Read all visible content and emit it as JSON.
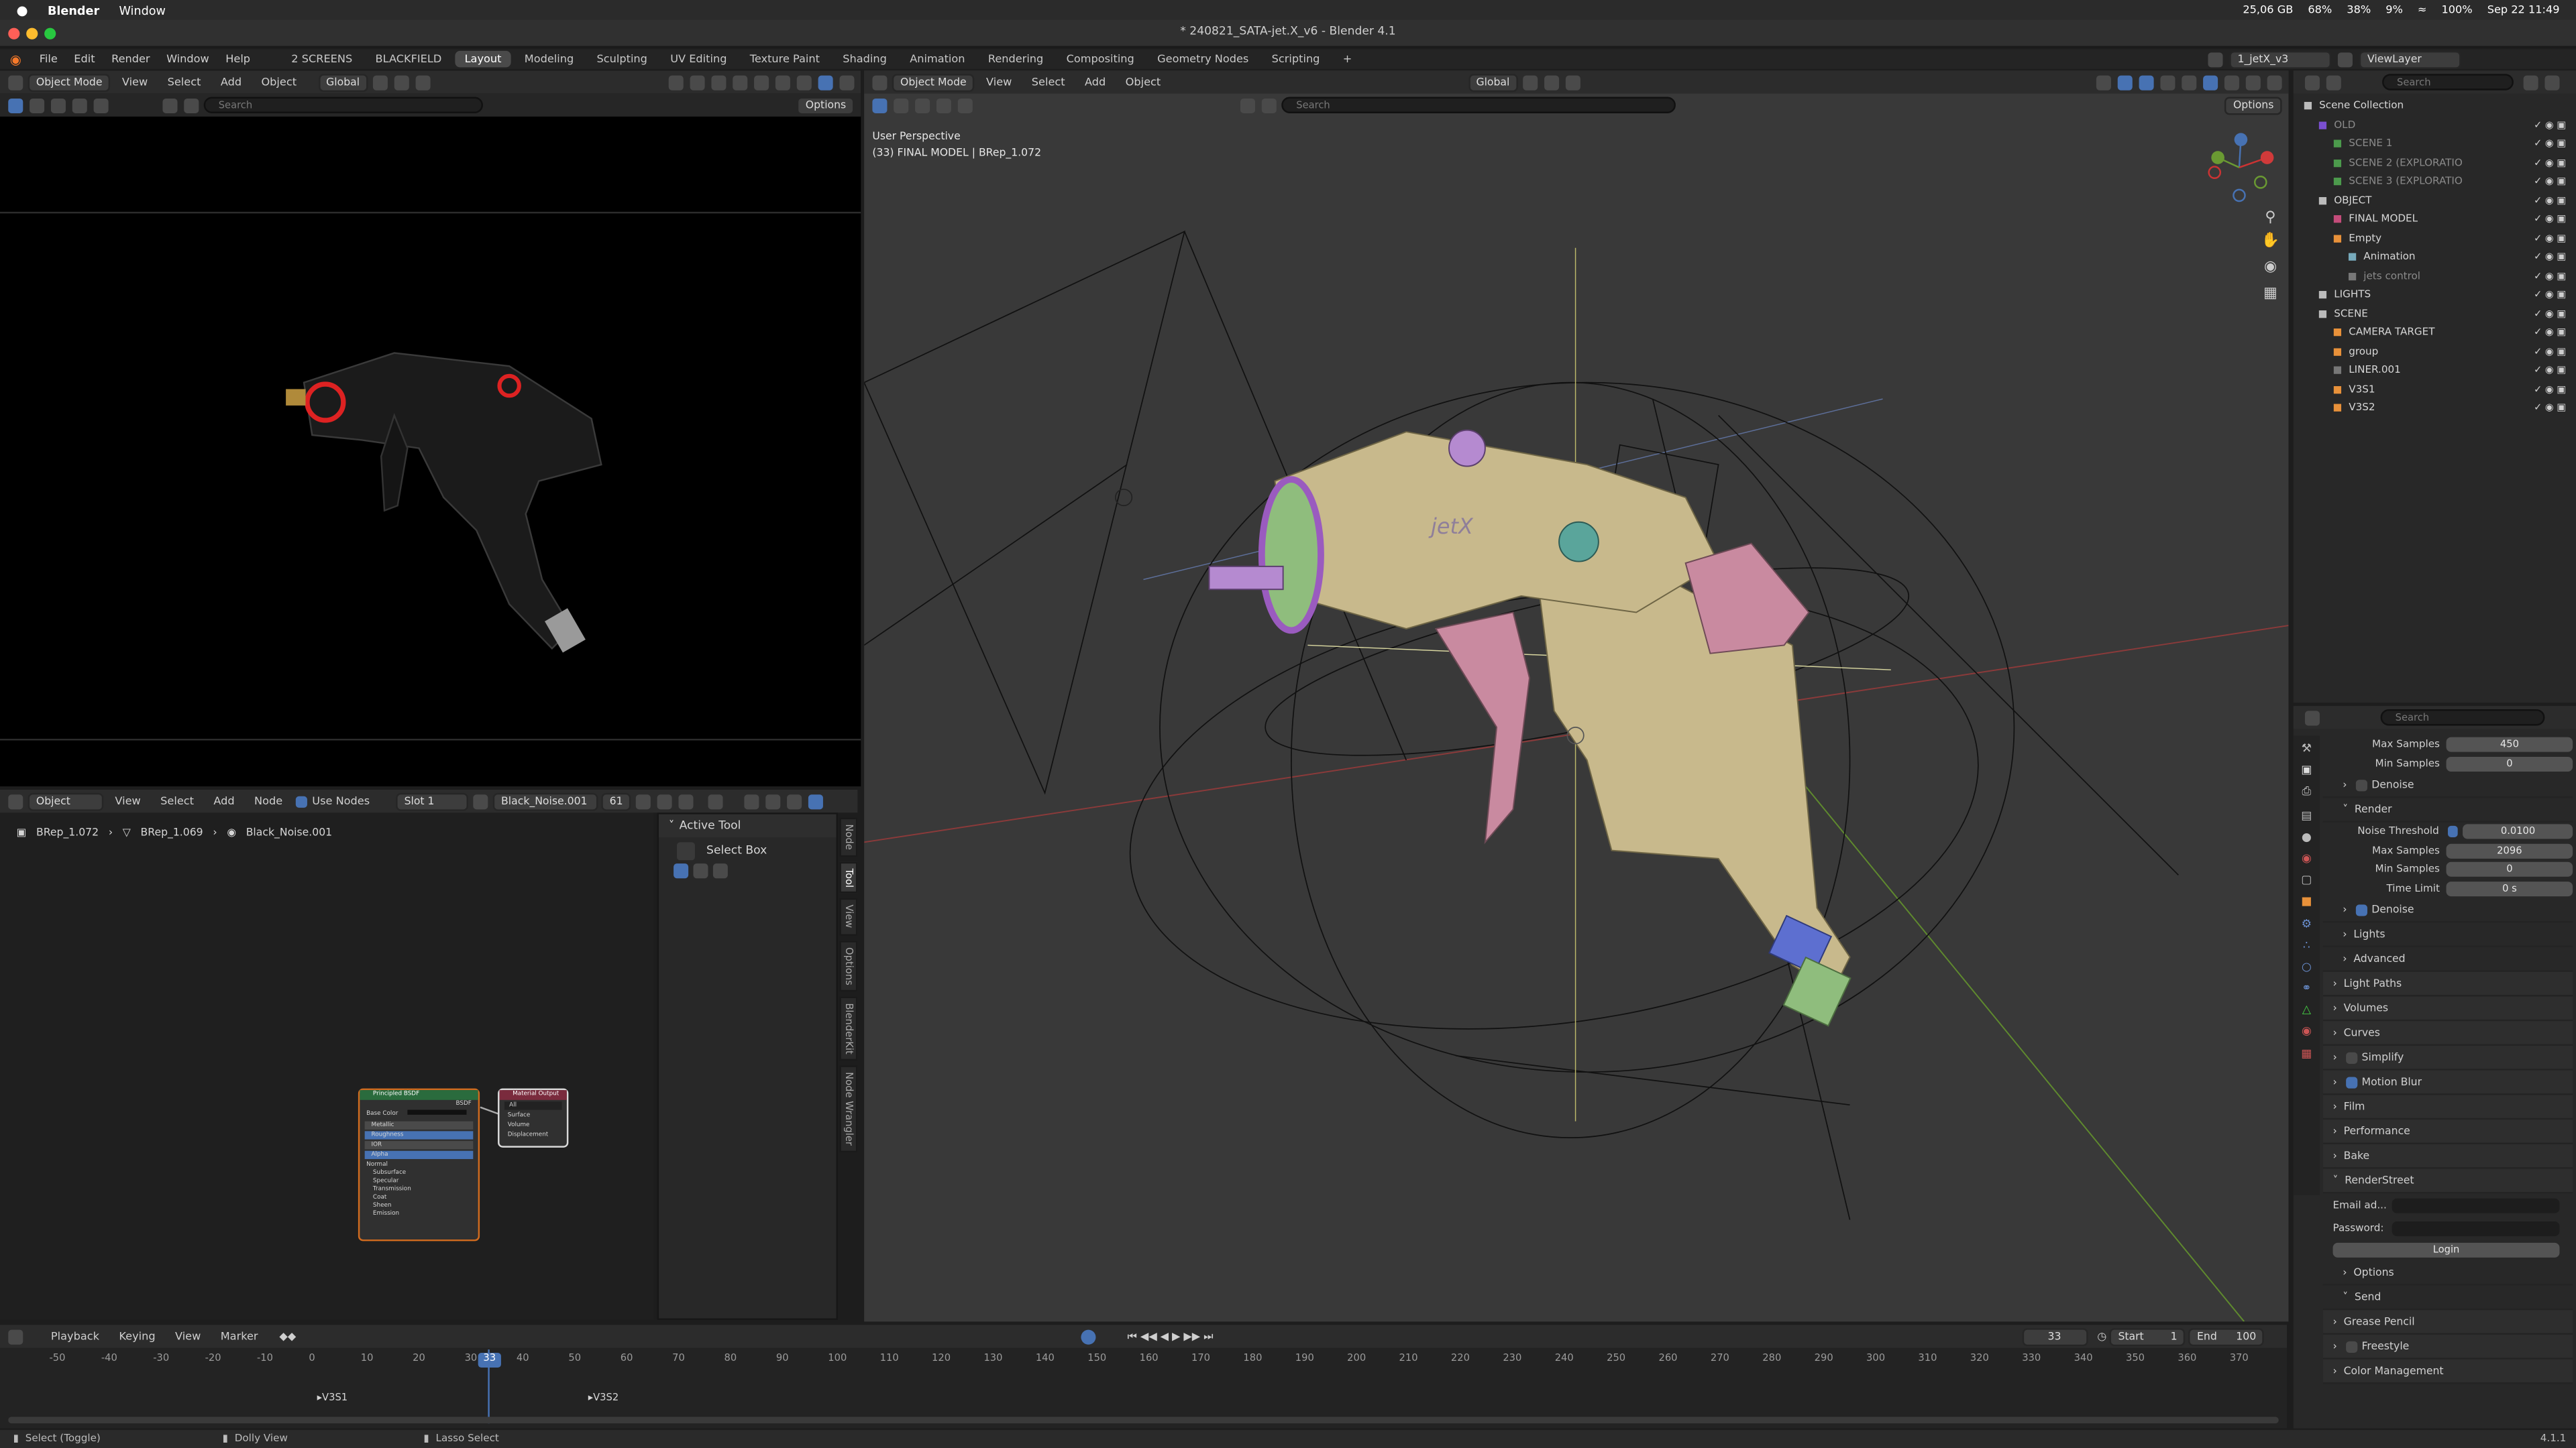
{
  "mac_menubar": {
    "app": "Blender",
    "menu": "Window",
    "storage": "25,06 GB",
    "stat1": "68%",
    "stat2": "38%",
    "stat3": "9%",
    "battery": "100%",
    "datetime": "Sep 22  11:49"
  },
  "window_title": "* 240821_SATA-jet.X_v6 - Blender 4.1",
  "top_menu": [
    "File",
    "Edit",
    "Render",
    "Window",
    "Help"
  ],
  "workspaces": [
    "2 SCREENS",
    "BLACKFIELD",
    "Layout",
    "Modeling",
    "Sculpting",
    "UV Editing",
    "Texture Paint",
    "Shading",
    "Animation",
    "Rendering",
    "Compositing",
    "Geometry Nodes",
    "Scripting"
  ],
  "active_workspace": "Layout",
  "scene_field": "1_jetX_v3",
  "view_layer": "ViewLayer",
  "left_viewport": {
    "mode": "Object Mode",
    "menus": [
      "View",
      "Select",
      "Add",
      "Object"
    ],
    "orientation": "Global",
    "options": "Options",
    "search": "Search"
  },
  "main_viewport": {
    "mode": "Object Mode",
    "menus": [
      "View",
      "Select",
      "Add",
      "Object"
    ],
    "orientation": "Global",
    "options": "Options",
    "search": "Search",
    "overlay_line1": "User Perspective",
    "overlay_line2": "(33) FINAL MODEL | BRep_1.072",
    "model_label": "jetX"
  },
  "node_editor": {
    "type": "Object",
    "menus": [
      "View",
      "Select",
      "Add",
      "Node"
    ],
    "use_nodes": "Use Nodes",
    "slot": "Slot 1",
    "material": "Black_Noise.001",
    "users": "61",
    "breadcrumb": [
      "BRep_1.072",
      "BRep_1.069",
      "Black_Noise.001"
    ],
    "node1": {
      "title": "Principled BSDF",
      "out": "BSDF",
      "rows": [
        "Base Color",
        "Metallic",
        "Roughness",
        "IOR",
        "Alpha",
        "Normal",
        "Subsurface",
        "Specular",
        "Transmission",
        "Coat",
        "Sheen",
        "Emission"
      ]
    },
    "node2": {
      "title": "Material Output",
      "sel": "All",
      "rows": [
        "Surface",
        "Volume",
        "Displacement"
      ]
    }
  },
  "sidebar": {
    "section": "Active Tool",
    "tool": "Select Box",
    "tabs": [
      "Node",
      "Tool",
      "View",
      "Options",
      "BlenderKit",
      "Node Wrangler"
    ]
  },
  "outliner": {
    "search": "Search",
    "items": [
      {
        "label": "Scene Collection",
        "indent": 0
      },
      {
        "label": "OLD",
        "indent": 1
      },
      {
        "label": "SCENE 1",
        "indent": 2
      },
      {
        "label": "SCENE 2 (EXPLORATIO",
        "indent": 2
      },
      {
        "label": "SCENE 3 (EXPLORATIO",
        "indent": 2
      },
      {
        "label": "OBJECT",
        "indent": 1
      },
      {
        "label": "FINAL MODEL",
        "indent": 2
      },
      {
        "label": "Empty",
        "indent": 2
      },
      {
        "label": "Animation",
        "indent": 3
      },
      {
        "label": "jets control",
        "indent": 3
      },
      {
        "label": "LIGHTS",
        "indent": 1
      },
      {
        "label": "SCENE",
        "indent": 1
      },
      {
        "label": "CAMERA TARGET",
        "indent": 2
      },
      {
        "label": "group",
        "indent": 2
      },
      {
        "label": "LINER.001",
        "indent": 2
      },
      {
        "label": "V3S1",
        "indent": 2
      },
      {
        "label": "V3S2",
        "indent": 2
      }
    ]
  },
  "properties": {
    "search": "Search",
    "rows": [
      {
        "label": "Max Samples",
        "value": "450",
        "kind": "field"
      },
      {
        "label": "Min Samples",
        "value": "0",
        "kind": "field"
      },
      {
        "label": "Denoise",
        "kind": "sub-check"
      },
      {
        "label": "Render",
        "kind": "sub-open"
      },
      {
        "label": "Noise Threshold",
        "value": "0.0100",
        "kind": "check-field"
      },
      {
        "label": "Max Samples",
        "value": "2096",
        "kind": "field"
      },
      {
        "label": "Min Samples",
        "value": "0",
        "kind": "field"
      },
      {
        "label": "Time Limit",
        "value": "0 s",
        "kind": "field"
      },
      {
        "label": "Denoise",
        "kind": "sub-check-on"
      },
      {
        "label": "Lights",
        "kind": "sub"
      },
      {
        "label": "Advanced",
        "kind": "sub"
      },
      {
        "label": "Light Paths",
        "kind": "panel"
      },
      {
        "label": "Volumes",
        "kind": "panel"
      },
      {
        "label": "Curves",
        "kind": "panel"
      },
      {
        "label": "Simplify",
        "kind": "panel-check"
      },
      {
        "label": "Motion Blur",
        "kind": "panel-check-on"
      },
      {
        "label": "Film",
        "kind": "panel"
      },
      {
        "label": "Performance",
        "kind": "panel"
      },
      {
        "label": "Bake",
        "kind": "panel"
      },
      {
        "label": "RenderStreet",
        "kind": "panel-open"
      },
      {
        "label": "Email ad...",
        "kind": "input"
      },
      {
        "label": "Password:",
        "kind": "input"
      },
      {
        "label": "Login",
        "kind": "button"
      },
      {
        "label": "Options",
        "kind": "sub"
      },
      {
        "label": "Send",
        "kind": "sub-open"
      },
      {
        "label": "Grease Pencil",
        "kind": "panel"
      },
      {
        "label": "Freestyle",
        "kind": "panel-check"
      },
      {
        "label": "Color Management",
        "kind": "panel"
      }
    ]
  },
  "timeline": {
    "menus": [
      "Playback",
      "Keying",
      "View",
      "Marker"
    ],
    "current_frame": "33",
    "start_label": "Start",
    "start": "1",
    "end_label": "End",
    "end": "100",
    "ticks": [
      "-50",
      "-40",
      "-30",
      "-20",
      "-10",
      "0",
      "10",
      "20",
      "30",
      "40",
      "50",
      "60",
      "70",
      "80",
      "90",
      "100",
      "110",
      "120",
      "130",
      "140",
      "150",
      "160",
      "170",
      "180",
      "190",
      "200",
      "210",
      "220",
      "230",
      "240",
      "250",
      "260",
      "270",
      "280",
      "290",
      "300",
      "310",
      "320",
      "330",
      "340",
      "350",
      "360",
      "370"
    ],
    "cameras": [
      "V3S1",
      "V3S2"
    ]
  },
  "statusbar": {
    "select": "Select (Toggle)",
    "dolly": "Dolly View",
    "lasso": "Lasso Select",
    "version": "4.1.1"
  },
  "colors": {
    "accent": "#4772b3",
    "selected_frame": "#4772b3"
  }
}
